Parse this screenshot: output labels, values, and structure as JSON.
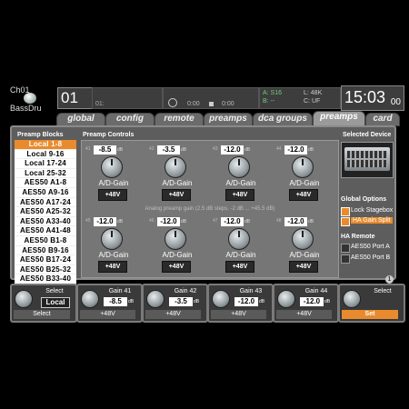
{
  "channel": {
    "label": "Ch01",
    "name": "BassDru"
  },
  "scene": {
    "number": "01",
    "position": "01:"
  },
  "transport": {
    "time1": "0:00",
    "time2": "0:00"
  },
  "status": {
    "a": "A: S16",
    "b": "B: --",
    "l": "L: 48K",
    "c": "C: UF"
  },
  "clock": "15:03",
  "clock_suffix": "00",
  "tabs": [
    "global",
    "config",
    "remote",
    "preamps",
    "dca groups",
    "preamps",
    "card"
  ],
  "active_tab": "preamps",
  "panel": {
    "blocks_title": "Preamp Blocks",
    "controls_title": "Preamp Controls",
    "device_title": "Selected Device",
    "blocks": [
      "Local 1-8",
      "Local 9-16",
      "Local 17-24",
      "Local 25-32",
      "AES50 A1-8",
      "AES50 A9-16",
      "AES50 A17-24",
      "AES50 A25-32",
      "AES50 A33-40",
      "AES50 A41-48",
      "AES50 B1-8",
      "AES50 B9-16",
      "AES50 B17-24",
      "AES50 B25-32",
      "AES50 B33-40",
      "AES50 B41-48"
    ],
    "preamps": [
      {
        "num": "41",
        "gain": "-8.5"
      },
      {
        "num": "42",
        "gain": "-3.5"
      },
      {
        "num": "43",
        "gain": "-12.0"
      },
      {
        "num": "44",
        "gain": "-12.0"
      },
      {
        "num": "45",
        "gain": "-12.0"
      },
      {
        "num": "46",
        "gain": "-12.0"
      },
      {
        "num": "47",
        "gain": "-12.0"
      },
      {
        "num": "48",
        "gain": "-12.0"
      }
    ],
    "knob_label": "A/D-Gain",
    "phantom_label": "+48V",
    "db_unit": "dB",
    "note": "Analog preamp gain (2.5 dB steps, -2 dB ... +45.5 dB)",
    "global_options_title": "Global Options",
    "lock_stagebox": "Lock Stagebox",
    "ha_gain_split": "HA Gain Split",
    "ha_remote_title": "HA Remote",
    "aes50_a": "AES50 Port A",
    "aes50_b": "AES50 Port B"
  },
  "bottom": {
    "select_label": "Select",
    "local_value": "Local",
    "select_button": "Select",
    "gains": [
      {
        "title": "Gain 41",
        "value": "-8.5",
        "unit": "dB",
        "button": "+48V"
      },
      {
        "title": "Gain 42",
        "value": "-3.5",
        "unit": "dB",
        "button": "+48V"
      },
      {
        "title": "Gain 43",
        "value": "-12.0",
        "unit": "dB",
        "button": "+48V"
      },
      {
        "title": "Gain 44",
        "value": "-12.0",
        "unit": "dB",
        "button": "+48V"
      }
    ],
    "right_select": "Select",
    "set_button": "Set"
  },
  "pager": "1",
  "colors": {
    "accent": "#e98b2c"
  }
}
